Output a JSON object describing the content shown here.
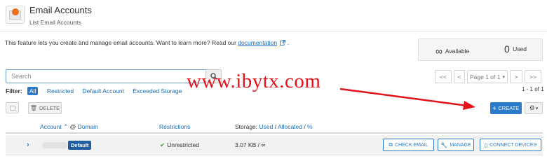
{
  "header": {
    "title": "Email Accounts",
    "subtitle": "List Email Accounts"
  },
  "intro": {
    "text": "This feature lets you create and manage email accounts. Want to learn more? Read our ",
    "link": "documentation",
    "suffix": "."
  },
  "stats": {
    "available_symbol": "∞",
    "available_label": "Available",
    "used_value": "0",
    "used_label": "Used"
  },
  "search": {
    "placeholder": "Search"
  },
  "filter": {
    "label": "Filter:",
    "options": [
      "All",
      "Restricted",
      "Default Account",
      "Exceeded Storage"
    ]
  },
  "watermark": "www.ibytx.com",
  "pagination": {
    "first": "<<",
    "prev": "<",
    "page": "Page 1 of 1",
    "next": ">",
    "last": ">>",
    "count": "1 - 1 of 1"
  },
  "toolbar": {
    "delete_label": "DELETE",
    "create_label": "CREATE"
  },
  "table": {
    "col_account": "Account",
    "col_sep": "@",
    "col_domain": "Domain",
    "col_restrictions": "Restrictions",
    "col_storage_prefix": "Storage:",
    "col_used": "Used",
    "col_allocated": "Allocated",
    "col_percent": "%",
    "row": {
      "badge": "Default",
      "restrictions": "Unrestricted",
      "storage": "3.07 KB / ∞",
      "check_email": "CHECK EMAIL",
      "manage": "MANAGE",
      "connect_devices": "CONNECT DEVICES"
    }
  },
  "colors": {
    "accent": "#2b7bca",
    "watermark": "#e4121b"
  }
}
